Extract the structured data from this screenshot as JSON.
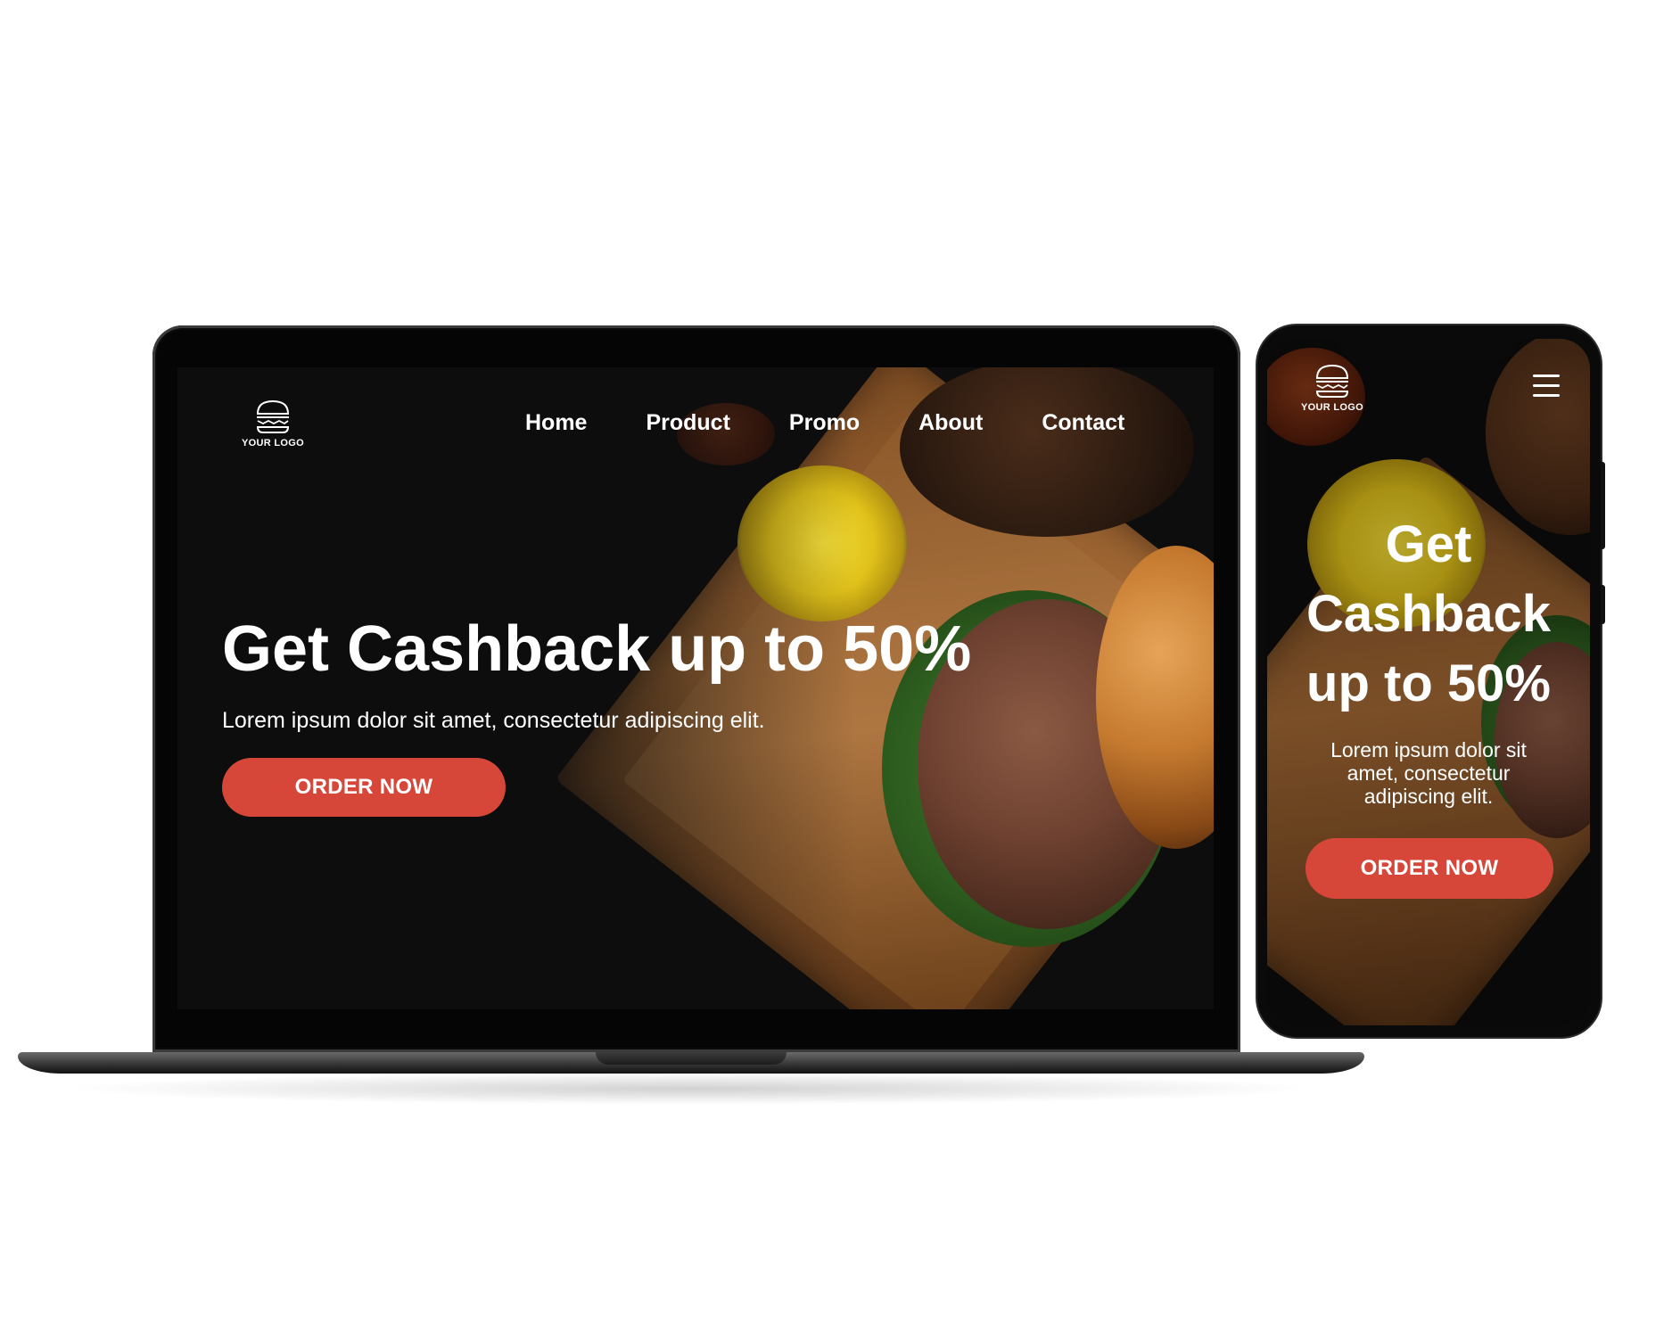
{
  "colors": {
    "accent": "#d6473a",
    "text": "#ffffff",
    "background": "#0d0d0d"
  },
  "desktop": {
    "logo": {
      "icon": "burger-icon",
      "text": "YOUR LOGO"
    },
    "nav": {
      "items": [
        {
          "label": "Home"
        },
        {
          "label": "Product"
        },
        {
          "label": "Promo"
        },
        {
          "label": "About"
        },
        {
          "label": "Contact"
        }
      ]
    },
    "hero": {
      "title": "Get Cashback up to 50%",
      "subtitle": "Lorem ipsum dolor sit amet, consectetur adipiscing elit.",
      "cta_label": "ORDER NOW"
    }
  },
  "mobile": {
    "logo": {
      "icon": "burger-icon",
      "text": "YOUR LOGO"
    },
    "menu_icon": "hamburger-menu-icon",
    "hero": {
      "title_line1": "Get",
      "title_line2": "Cashback",
      "title_line3": "up to 50%",
      "subtitle_line1": "Lorem ipsum dolor sit",
      "subtitle_line2": "amet, consectetur",
      "subtitle_line3": "adipiscing elit.",
      "cta_label": "ORDER NOW"
    }
  }
}
